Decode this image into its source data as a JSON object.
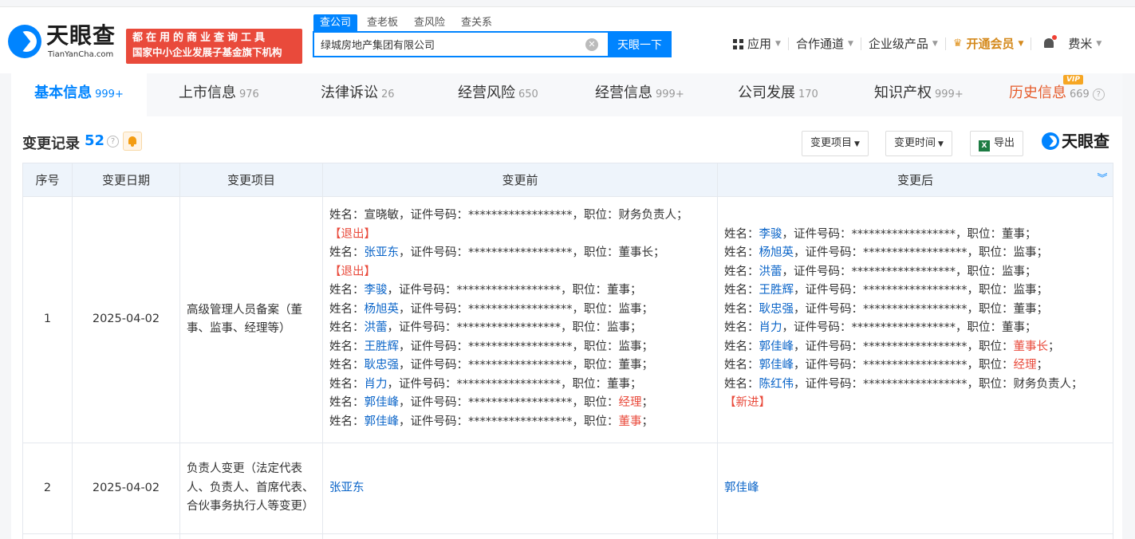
{
  "header": {
    "logo_cn": "天眼查",
    "logo_en": "TianYanCha.com",
    "slogan_line1": "都在用的商业查询工具",
    "slogan_line2": "国家中小企业发展子基金旗下机构",
    "search_tabs": [
      "查公司",
      "查老板",
      "查风险",
      "查关系"
    ],
    "search_value": "绿城房地产集团有限公司",
    "search_button": "天眼一下",
    "nav": {
      "apps": "应用",
      "cooperation": "合作通道",
      "enterprise": "企业级产品",
      "vip": "开通会员",
      "user": "费米"
    }
  },
  "tabs": [
    {
      "label": "基本信息",
      "count": "999+"
    },
    {
      "label": "上市信息",
      "count": "976"
    },
    {
      "label": "法律诉讼",
      "count": "26"
    },
    {
      "label": "经营风险",
      "count": "650"
    },
    {
      "label": "经营信息",
      "count": "999+"
    },
    {
      "label": "公司发展",
      "count": "170"
    },
    {
      "label": "知识产权",
      "count": "999+"
    },
    {
      "label": "历史信息",
      "count": "669",
      "badge": "VIP"
    }
  ],
  "section": {
    "title": "变更记录",
    "count": "52",
    "filter_item": "变更项目",
    "filter_time": "变更时间",
    "export": "导出",
    "watermark": "天眼查"
  },
  "table": {
    "headers": [
      "序号",
      "变更日期",
      "变更项目",
      "变更前",
      "变更后"
    ],
    "labels": {
      "name": "姓名：",
      "id": "证件号码：",
      "mask": "******************",
      "pos": "职位："
    },
    "rows": [
      {
        "no": "1",
        "date": "2025-04-02",
        "item": "高级管理人员备案（董事、监事、经理等）",
        "before": [
          {
            "name": "宣晓敏",
            "pos": "财务负责人",
            "tag": "【退出】"
          },
          {
            "name": "张亚东",
            "pos": "董事长",
            "tag": "【退出】"
          },
          {
            "name": "李骏",
            "pos": "董事"
          },
          {
            "name": "杨旭英",
            "pos": "监事"
          },
          {
            "name": "洪蕾",
            "pos": "监事"
          },
          {
            "name": "王胜辉",
            "pos": "监事"
          },
          {
            "name": "耿忠强",
            "pos": "董事"
          },
          {
            "name": "肖力",
            "pos": "董事"
          },
          {
            "name": "郭佳峰",
            "pos": "经理"
          },
          {
            "name": "郭佳峰",
            "pos": "董事"
          }
        ],
        "after": [
          {
            "name": "李骏",
            "pos": "董事"
          },
          {
            "name": "杨旭英",
            "pos": "监事"
          },
          {
            "name": "洪蕾",
            "pos": "监事"
          },
          {
            "name": "王胜辉",
            "pos": "监事"
          },
          {
            "name": "耿忠强",
            "pos": "董事"
          },
          {
            "name": "肖力",
            "pos": "董事"
          },
          {
            "name": "郭佳峰",
            "pos": "董事长"
          },
          {
            "name": "郭佳峰",
            "pos": "经理"
          },
          {
            "name": "陈红伟",
            "pos": "财务负责人",
            "tag": "【新进】"
          }
        ]
      },
      {
        "no": "2",
        "date": "2025-04-02",
        "item": "负责人变更（法定代表人、负责人、首席代表、合伙事务执行人等变更）",
        "before_text": "张亚东",
        "after_text": "郭佳峰"
      }
    ]
  },
  "colors": {
    "accent": "#0084ff",
    "red": "#e94a3b",
    "vip": "#d4891c"
  }
}
